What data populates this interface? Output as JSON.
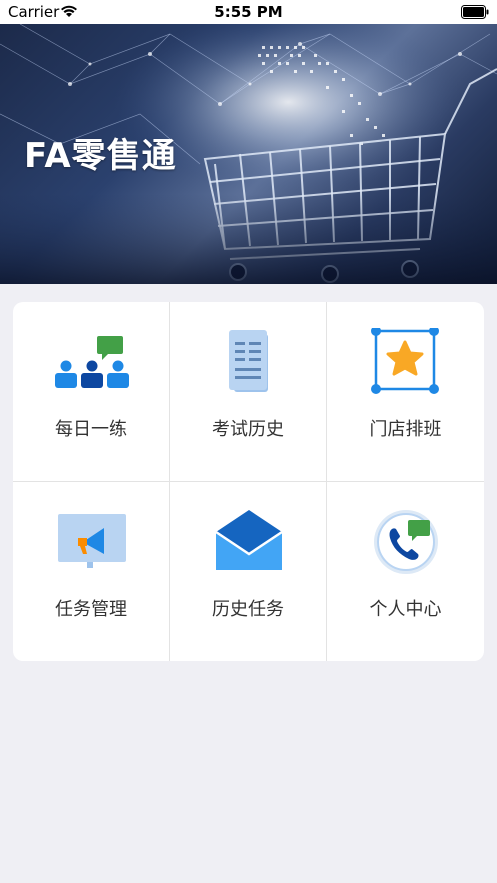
{
  "status_bar": {
    "carrier": "Carrier",
    "time": "5:55 PM"
  },
  "banner": {
    "title": "FA零售通"
  },
  "menu": {
    "items": [
      {
        "label": "每日一练",
        "icon": "team-chat-icon"
      },
      {
        "label": "考试历史",
        "icon": "document-icon"
      },
      {
        "label": "门店排班",
        "icon": "star-frame-icon"
      },
      {
        "label": "任务管理",
        "icon": "megaphone-icon"
      },
      {
        "label": "历史任务",
        "icon": "envelope-icon"
      },
      {
        "label": "个人中心",
        "icon": "phone-chat-icon"
      }
    ]
  },
  "colors": {
    "background": "#efeff4",
    "card": "#ffffff",
    "accent_blue": "#1e88e5",
    "accent_green": "#43a047",
    "accent_orange": "#fb8c00",
    "accent_yellow": "#f9a825"
  }
}
